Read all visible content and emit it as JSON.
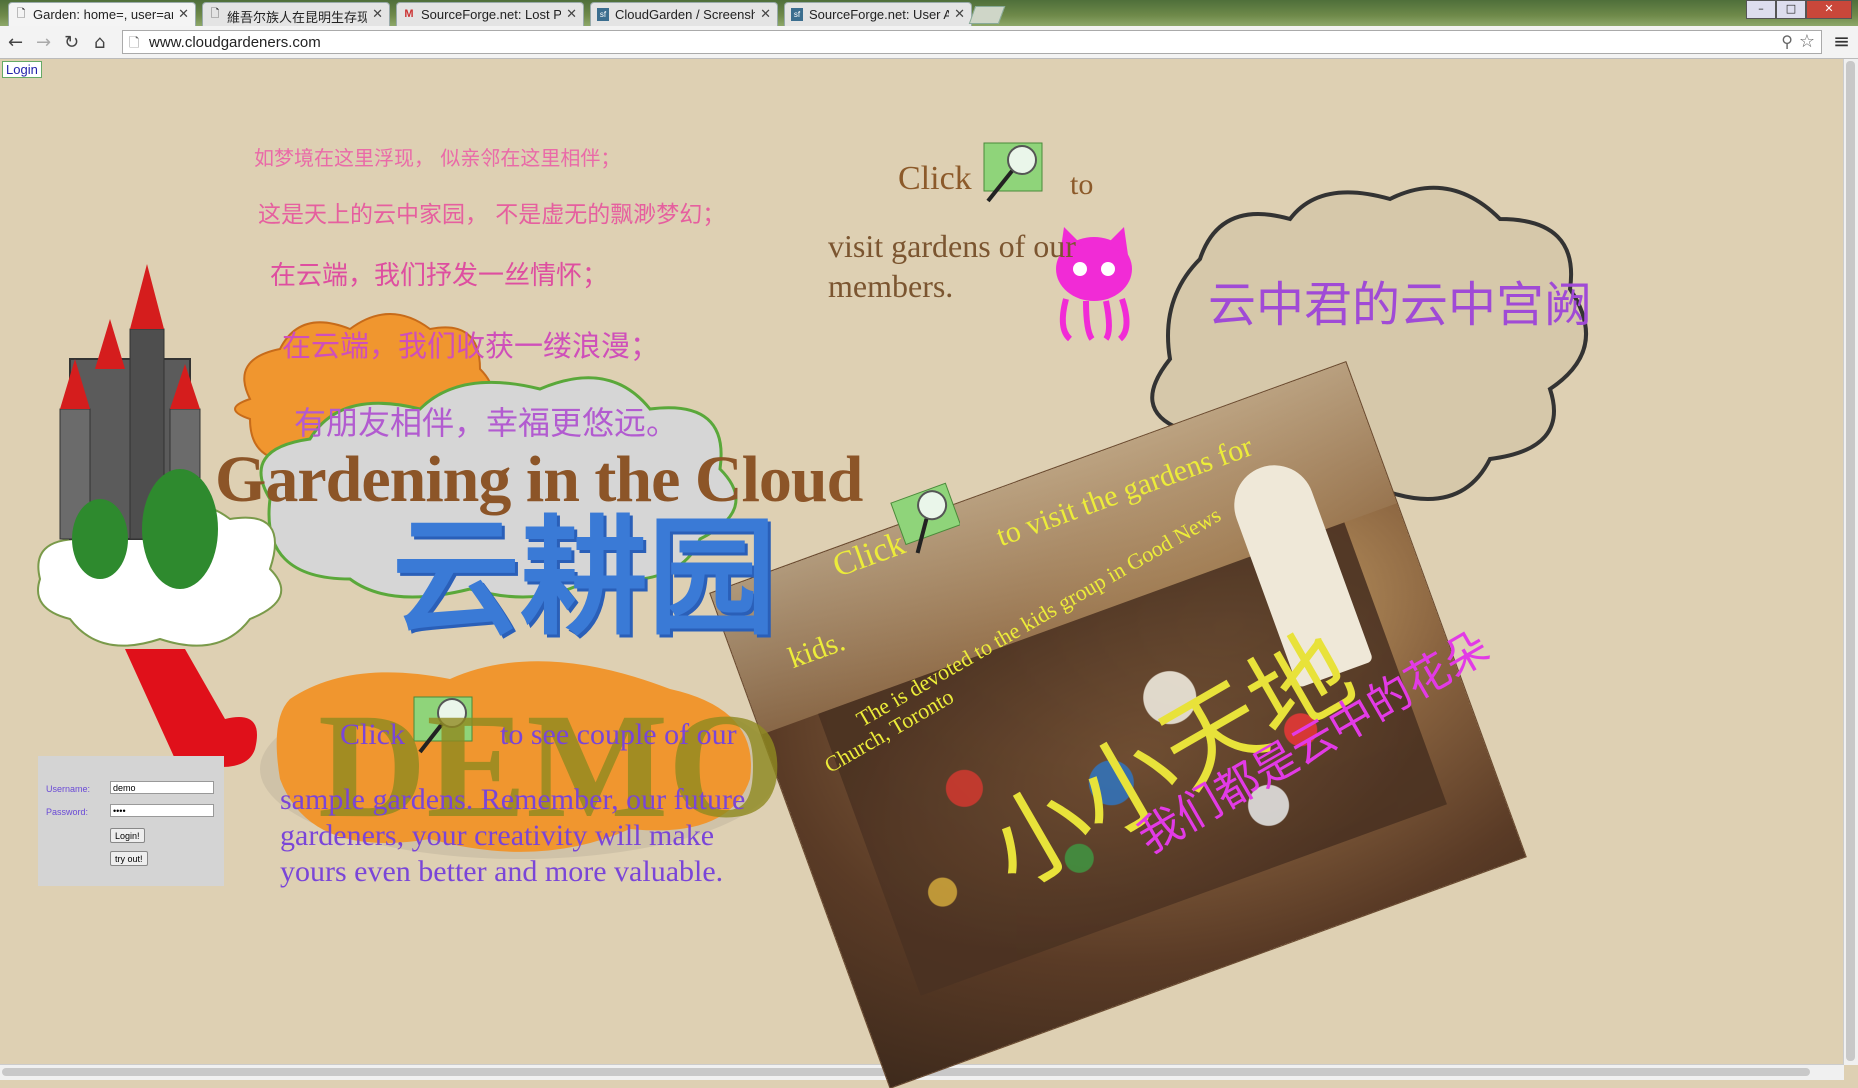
{
  "browser": {
    "tabs": [
      {
        "title": "Garden: home=, user=anc",
        "icon": "page"
      },
      {
        "title": "維吾尔族人在昆明生存现",
        "icon": "page"
      },
      {
        "title": "SourceForge.net: Lost Pas",
        "icon": "gmail"
      },
      {
        "title": "CloudGarden / Screenshot",
        "icon": "sf"
      },
      {
        "title": "SourceForge.net: User Ac",
        "icon": "sf"
      }
    ],
    "url": "www.cloudgardeners.com",
    "window_buttons": {
      "minimize": "–",
      "maximize": "□",
      "close": "✕"
    }
  },
  "page": {
    "login_link": "Login",
    "poem": [
      "如梦境在这里浮现， 似亲邻在这里相伴；",
      "这是天上的云中家园， 不是虚无的飘渺梦幻；",
      "在云端，我们抒发一丝情怀；",
      "在云端，我们收获一缕浪漫；",
      "有朋友相伴，幸福更悠远。"
    ],
    "top_click": {
      "click": "Click",
      "to": "to",
      "visit": "visit gardens of our members."
    },
    "title_en": "Gardening in the Cloud",
    "title_cn": "云耕园",
    "cloud_bubble": "云中君的云中宫阙",
    "demo": {
      "badge": "DEMO",
      "click": "Click",
      "to": "to see couple of our",
      "desc": "sample gardens. Remember, our future gardeners, your creativity will make yours even better and more valuable."
    },
    "login_form": {
      "username_label": "Username:",
      "password_label": "Password:",
      "username_value": "demo",
      "password_value": "••••",
      "login_button": "Login!",
      "try_button": "try out!"
    },
    "kids": {
      "click": "Click",
      "visit": "to visit the gardens for",
      "kids": "kids.",
      "devoted": "The is devoted to the kids group in Good News",
      "church": "Church, Toronto",
      "cn_big": "小小天地",
      "cn_pink": "我们都是云中的花朵"
    }
  },
  "colors": {
    "page_bg": "#ded0b3",
    "poem_pink": "#e04c9c",
    "title_brown": "#8c5528",
    "title_blue": "#3a7ad6",
    "demo_purple": "#7a45d8",
    "photo_text_yellow": "#ecec3a"
  }
}
